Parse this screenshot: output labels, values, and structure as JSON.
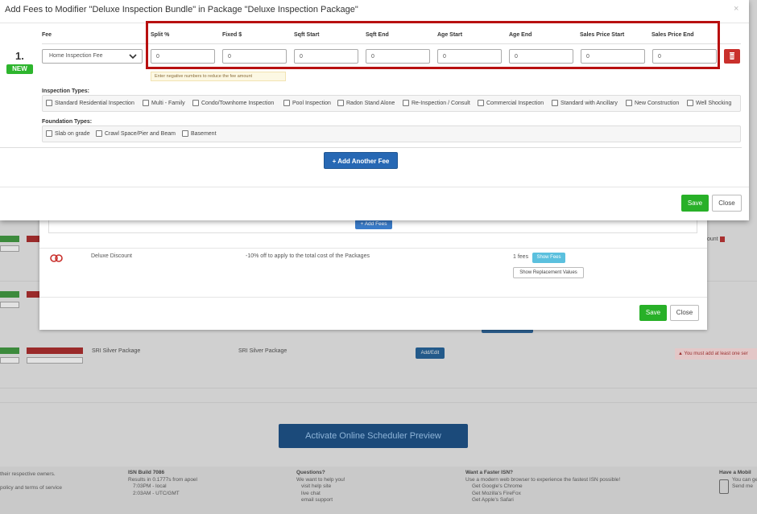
{
  "modal": {
    "title": "Add Fees to Modifier \"Deluxe Inspection Bundle\" in Package \"Deluxe Inspection Package\"",
    "close_glyph": "×",
    "columns": [
      "Fee",
      "Split %",
      "Fixed $",
      "Sqft Start",
      "Sqft End",
      "Age Start",
      "Age End",
      "Sales Price Start",
      "Sales Price End"
    ],
    "row": {
      "number": "1.",
      "badge": "NEW",
      "fee_select": "Home Inspection Fee",
      "values": [
        "0",
        "0",
        "0",
        "0",
        "0",
        "0",
        "0",
        "0"
      ],
      "hint": "Enter negative numbers to reduce the fee amount"
    },
    "inspection_types": {
      "label": "Inspection Types:",
      "items": [
        "Standard Residential Inspection",
        "Multi - Family",
        "Condo/Townhome Inspection",
        "Pool Inspection",
        "Radon Stand Alone",
        "Re-Inspection / Consult",
        "Commercial Inspection",
        "Standard with Ancillary",
        "New Construction",
        "Well Shocking"
      ]
    },
    "foundation_types": {
      "label": "Foundation Types:",
      "items": [
        "Slab on grade",
        "Crawl Space/Pier and Beam",
        "Basement"
      ]
    },
    "add_another_label": "+ Add Another Fee",
    "save_label": "Save",
    "close_label": "Close"
  },
  "middle": {
    "add_fees_label": "+ Add Fees",
    "discount_name": "Deluxe Discount",
    "discount_desc": "-10% off to apply to the total cost of the Packages",
    "fee_count": "1 fees",
    "show_fees_label": "Show Fees",
    "show_replacement_label": "Show Replacement Values",
    "save_label": "Save",
    "close_label": "Close"
  },
  "background": {
    "silver_name": "SRI Silver Package",
    "silver_desc": "SRI Silver Package",
    "add_edit_label": "Add/Edit",
    "warning": "You must add at least one ser",
    "discount_fragment": "ount",
    "activate_label": "Activate Online Scheduler Preview",
    "footer": {
      "left": [
        "their respective owners.",
        "",
        "policy and terms of service"
      ],
      "build_title": "ISN Build 7086",
      "build_lines": [
        "Results in 0.1777s from apoel",
        "7:03PM - local",
        "2:03AM - UTC/GMT"
      ],
      "questions_title": "Questions?",
      "questions_lines": [
        "We want to help you!",
        "visit help site",
        "live chat",
        "email support"
      ],
      "faster_title": "Want a Faster ISN?",
      "faster_lines": [
        "Use a modern web browser to experience the fastest ISN possible!",
        "Get Google's Chrome",
        "Get Mozilla's FireFox",
        "Get Apple's Safari"
      ],
      "mobile_title": "Have a Mobil",
      "mobile_lines": [
        "You can ge",
        "Send me"
      ]
    }
  },
  "colors": {
    "accent_blue": "#2768b4",
    "save_green": "#28b028",
    "danger_red": "#c9302c",
    "highlight_outline": "#b81010",
    "new_badge": "#2db52d"
  }
}
